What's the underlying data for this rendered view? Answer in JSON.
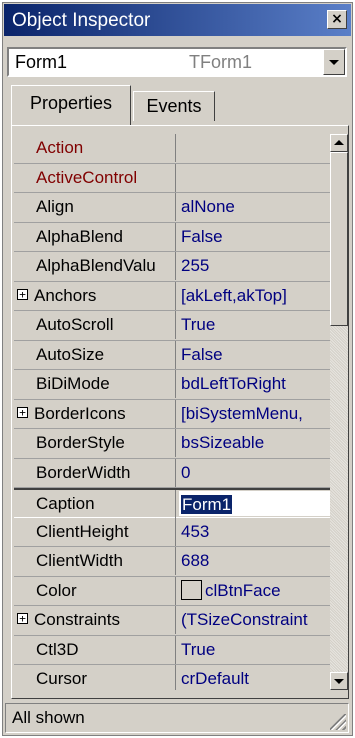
{
  "window": {
    "title": "Object Inspector",
    "close_label": "×"
  },
  "object_selector": {
    "name": "Form1",
    "type": "TForm1"
  },
  "tabs": [
    {
      "label": "Properties",
      "active": true
    },
    {
      "label": "Events",
      "active": false
    }
  ],
  "properties": [
    {
      "name": "Action",
      "value": "",
      "kind": "event"
    },
    {
      "name": "ActiveControl",
      "value": "",
      "kind": "event"
    },
    {
      "name": "Align",
      "value": "alNone"
    },
    {
      "name": "AlphaBlend",
      "value": "False"
    },
    {
      "name": "AlphaBlendValu",
      "value": "255"
    },
    {
      "name": "Anchors",
      "value": "[akLeft,akTop]",
      "expandable": true
    },
    {
      "name": "AutoScroll",
      "value": "True"
    },
    {
      "name": "AutoSize",
      "value": "False"
    },
    {
      "name": "BiDiMode",
      "value": "bdLeftToRight"
    },
    {
      "name": "BorderIcons",
      "value": "[biSystemMenu,",
      "expandable": true
    },
    {
      "name": "BorderStyle",
      "value": "bsSizeable"
    },
    {
      "name": "BorderWidth",
      "value": "0"
    },
    {
      "name": "Caption",
      "value": "Form1",
      "selected": true
    },
    {
      "name": "ClientHeight",
      "value": "453"
    },
    {
      "name": "ClientWidth",
      "value": "688"
    },
    {
      "name": "Color",
      "value": "clBtnFace",
      "swatch": "#d4d0c8"
    },
    {
      "name": "Constraints",
      "value": "(TSizeConstraint",
      "expandable": true
    },
    {
      "name": "Ctl3D",
      "value": "True"
    },
    {
      "name": "Cursor",
      "value": "crDefault"
    }
  ],
  "status": {
    "text": "All shown"
  },
  "colors": {
    "titlebar_start": "#0a246a",
    "titlebar_end": "#5a7fc8",
    "face": "#d4d0c8",
    "value_text": "#000080",
    "event_text": "#800000",
    "selection": "#0a246a"
  }
}
